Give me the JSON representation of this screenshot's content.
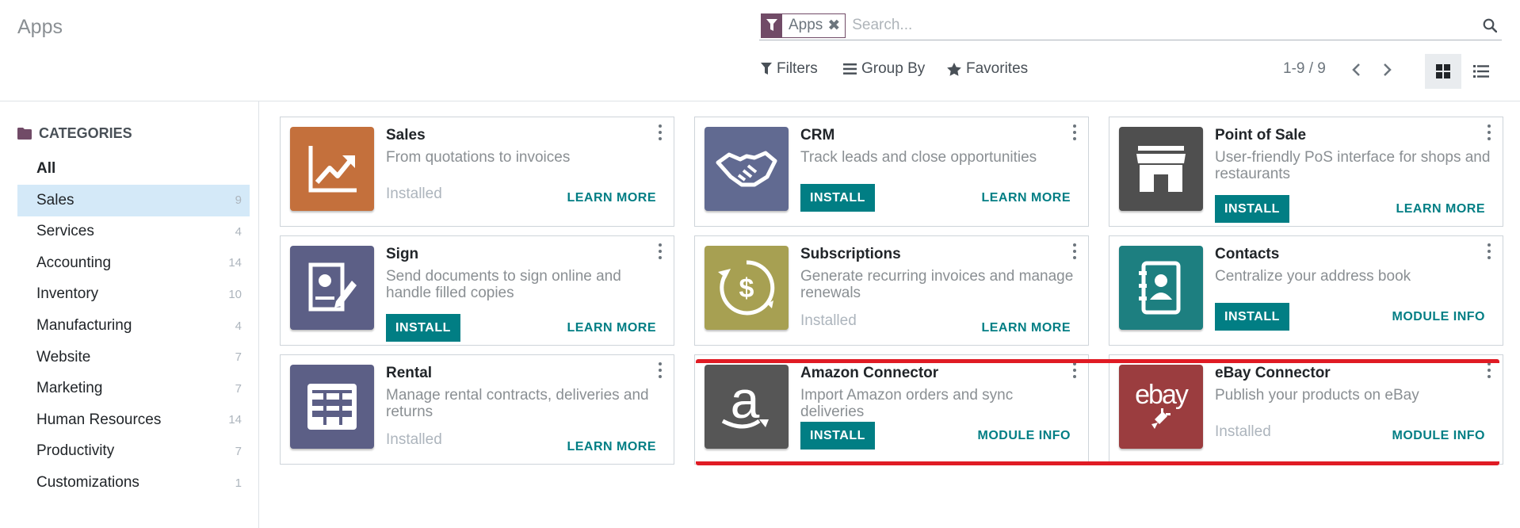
{
  "page": {
    "title": "Apps"
  },
  "search": {
    "facet_label": "Apps",
    "facet_remove": "✖",
    "placeholder": "Search..."
  },
  "control_panel": {
    "filters_label": "Filters",
    "groupby_label": "Group By",
    "favorites_label": "Favorites",
    "pager_value": "1-9 / 9"
  },
  "colors": {
    "brand": "#714b67",
    "accent": "#017e84",
    "active_category": "#d4e9f8",
    "highlight": "#e01b24"
  },
  "sidebar": {
    "header": "CATEGORIES",
    "items": [
      {
        "label": "All",
        "count": ""
      },
      {
        "label": "Sales",
        "count": "9"
      },
      {
        "label": "Services",
        "count": "4"
      },
      {
        "label": "Accounting",
        "count": "14"
      },
      {
        "label": "Inventory",
        "count": "10"
      },
      {
        "label": "Manufacturing",
        "count": "4"
      },
      {
        "label": "Website",
        "count": "7"
      },
      {
        "label": "Marketing",
        "count": "7"
      },
      {
        "label": "Human Resources",
        "count": "14"
      },
      {
        "label": "Productivity",
        "count": "7"
      },
      {
        "label": "Customizations",
        "count": "1"
      }
    ]
  },
  "apps": [
    {
      "name": "Sales",
      "summary": "From quotations to invoices",
      "status": "Installed",
      "install_label": "",
      "link_label": "LEARN MORE",
      "icon": "sales-chart-icon",
      "color": "#c4703c"
    },
    {
      "name": "CRM",
      "summary": "Track leads and close opportunities",
      "status": "",
      "install_label": "INSTALL",
      "link_label": "LEARN MORE",
      "icon": "handshake-icon",
      "color": "#616a91"
    },
    {
      "name": "Point of Sale",
      "summary": "User-friendly PoS interface for shops and restaurants",
      "status": "",
      "install_label": "INSTALL",
      "link_label": "LEARN MORE",
      "icon": "shop-icon",
      "color": "#4f4f4f"
    },
    {
      "name": "Sign",
      "summary": "Send documents to sign online and handle filled copies",
      "status": "",
      "install_label": "INSTALL",
      "link_label": "LEARN MORE",
      "icon": "sign-document-icon",
      "color": "#5c5f86"
    },
    {
      "name": "Subscriptions",
      "summary": "Generate recurring invoices and manage renewals",
      "status": "Installed",
      "install_label": "",
      "link_label": "LEARN MORE",
      "icon": "recurring-dollar-icon",
      "color": "#a7a052"
    },
    {
      "name": "Contacts",
      "summary": "Centralize your address book",
      "status": "",
      "install_label": "INSTALL",
      "link_label": "MODULE INFO",
      "icon": "address-book-icon",
      "color": "#1d7f80"
    },
    {
      "name": "Rental",
      "summary": "Manage rental contracts, deliveries and returns",
      "status": "Installed",
      "install_label": "",
      "link_label": "LEARN MORE",
      "icon": "rental-table-icon",
      "color": "#5c5f86"
    },
    {
      "name": "Amazon Connector",
      "summary": "Import Amazon orders and sync deliveries",
      "status": "",
      "install_label": "INSTALL",
      "link_label": "MODULE INFO",
      "icon": "amazon-logo-icon",
      "color": "#565656"
    },
    {
      "name": "eBay Connector",
      "summary": "Publish your products on eBay",
      "status": "Installed",
      "install_label": "",
      "link_label": "MODULE INFO",
      "icon": "ebay-logo-icon",
      "color": "#9b3d3f",
      "logo_text": "ebay"
    }
  ]
}
